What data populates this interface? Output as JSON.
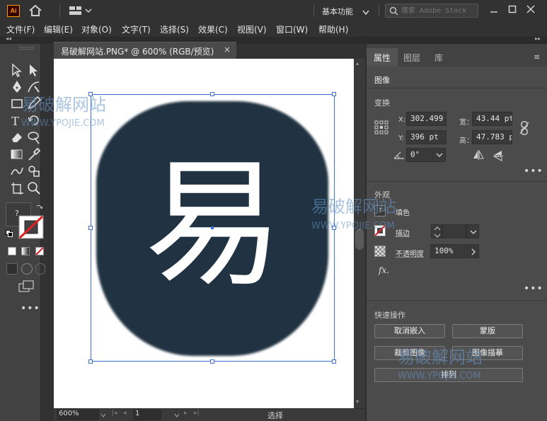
{
  "app": {
    "logo_text": "Ai",
    "workspace_label": "基本功能",
    "search_placeholder": "搜索 Adobe Stock"
  },
  "menu": [
    "文件(F)",
    "编辑(E)",
    "对象(O)",
    "文字(T)",
    "选择(S)",
    "效果(C)",
    "视图(V)",
    "窗口(W)",
    "帮助(H)"
  ],
  "document": {
    "tab_title": "易破解网站.PNG* @ 600% (RGB/预览)",
    "close_glyph": "×",
    "artwork_char": "易",
    "artwork_bg": "#213342"
  },
  "status": {
    "zoom": "600%",
    "page": "1",
    "tool_name": "选择"
  },
  "panel": {
    "tabs": [
      "属性",
      "图层",
      "库"
    ],
    "object_type": "图像",
    "transform": {
      "title": "变换",
      "x_label": "X:",
      "x_value": "302.499",
      "y_label": "Y:",
      "y_value": "396 pt",
      "w_label": "宽：",
      "w_value": "43.44 pt",
      "h_label": "高：",
      "h_value": "47.783 p",
      "angle_value": "0°"
    },
    "appearance": {
      "title": "外观",
      "fill_label": "填色",
      "stroke_label": "描边",
      "opacity_label": "不透明度",
      "opacity_value": "100%",
      "fx_label": "fx."
    },
    "quick_actions": {
      "title": "快速操作",
      "unembed": "取消嵌入",
      "mask": "蒙版",
      "crop": "裁剪图像",
      "trace": "图像描摹",
      "arrange": "排列"
    }
  },
  "watermarks": {
    "cn": "易破解网站",
    "en": "WWW.YPOJIE.COM"
  },
  "colors": {
    "accent_orange": "#ff9a00",
    "selection_blue": "#3c6fd6",
    "stroke_red": "#e02020"
  }
}
